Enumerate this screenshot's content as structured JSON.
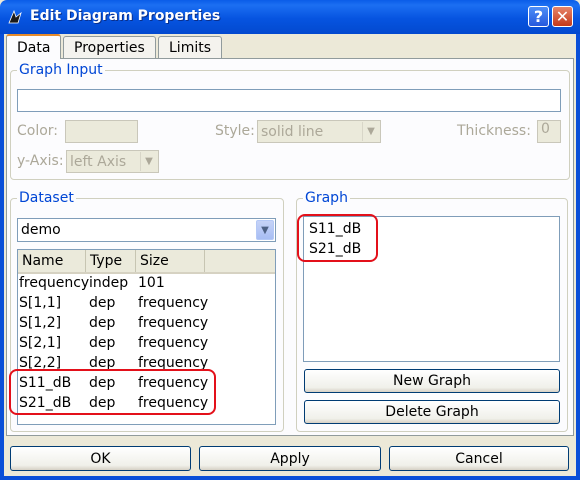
{
  "window": {
    "title": "Edit Diagram Properties",
    "help_symbol": "?",
    "close_symbol": "✕",
    "icon": "app-icon"
  },
  "tabs": [
    {
      "label": "Data",
      "active": true
    },
    {
      "label": "Properties",
      "active": false
    },
    {
      "label": "Limits",
      "active": false
    }
  ],
  "graph_input": {
    "title": "Graph Input",
    "value": "",
    "color_label": "Color:",
    "style_label": "Style:",
    "style_value": "solid line",
    "thickness_label": "Thickness:",
    "thickness_value": "0",
    "yaxis_label": "y-Axis:",
    "yaxis_value": "left Axis"
  },
  "dataset": {
    "title": "Dataset",
    "selected": "demo",
    "columns": [
      "Name",
      "Type",
      "Size"
    ],
    "rows": [
      {
        "name": "frequency",
        "type": "indep",
        "size": "101"
      },
      {
        "name": "S[1,1]",
        "type": "dep",
        "size": "frequency"
      },
      {
        "name": "S[1,2]",
        "type": "dep",
        "size": "frequency"
      },
      {
        "name": "S[2,1]",
        "type": "dep",
        "size": "frequency"
      },
      {
        "name": "S[2,2]",
        "type": "dep",
        "size": "frequency"
      },
      {
        "name": "S11_dB",
        "type": "dep",
        "size": "frequency"
      },
      {
        "name": "S21_dB",
        "type": "dep",
        "size": "frequency"
      }
    ]
  },
  "graph": {
    "title": "Graph",
    "items": [
      "S11_dB",
      "S21_dB"
    ],
    "new_button": "New Graph",
    "delete_button": "Delete Graph"
  },
  "footer": {
    "ok": "OK",
    "apply": "Apply",
    "cancel": "Cancel"
  },
  "colors": {
    "title_bar": "#0654e0",
    "group_title": "#0046d5",
    "highlight": "#e3101a",
    "dialog_bg": "#ece9d8"
  }
}
